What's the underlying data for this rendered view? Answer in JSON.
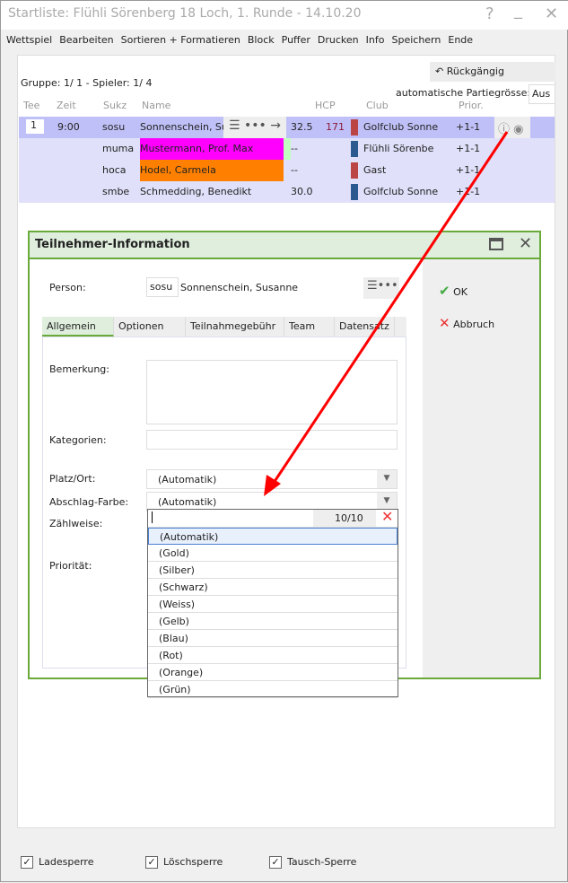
{
  "window": {
    "title": "Startliste: Flühli Sörenberg 18 Loch, 1. Runde - 14.10.20",
    "help": "?",
    "minimize": "_",
    "close": "✕"
  },
  "menu": [
    "Wettspiel",
    "Bearbeiten",
    "Sortieren + Formatieren",
    "Block",
    "Puffer",
    "Drucken",
    "Info",
    "Speichern",
    "Ende"
  ],
  "undo": "Rückgängig",
  "group_info": "Gruppe:  1/  1 - Spieler:  1/  4",
  "auto_label": "automatische Partiegrösse:",
  "auto_value": "Aus",
  "columns": [
    "Tee",
    "Zeit",
    "Sukz",
    "Name",
    "HCP",
    "Club",
    "Prior."
  ],
  "rows": [
    {
      "tee": "1",
      "time": "9:00",
      "code": "sosu",
      "name": "Sonnenschein, Sus",
      "hcp": "32.5",
      "extra": "171",
      "club": "Golfclub Sonne",
      "prior": "+1-1",
      "gender": "f"
    },
    {
      "code": "muma",
      "name": "Mustermann, Prof. Max",
      "hcp": "--",
      "club": "Flühli Sörenbe",
      "prior": "+1-1",
      "gender": "m",
      "color": "#ff00ff"
    },
    {
      "code": "hoca",
      "name": "Hodel, Carmela",
      "hcp": "--",
      "club": "Gast",
      "prior": "+1-1",
      "gender": "f",
      "color": "#ff8000"
    },
    {
      "code": "smbe",
      "name": "Schmedding, Benedikt",
      "hcp": "30.0",
      "club": "Golfclub Sonne",
      "prior": "+1-1",
      "gender": "m"
    }
  ],
  "dialog": {
    "title": "Teilnehmer-Information",
    "person_label": "Person:",
    "person_code": "sosu",
    "person_name": "Sonnenschein, Susanne",
    "ok": "OK",
    "cancel": "Abbruch",
    "tabs": [
      "Allgemein",
      "Optionen",
      "Teilnahmegebühr",
      "Team",
      "Datensatz"
    ],
    "bemerkung": "Bemerkung:",
    "kategorien": "Kategorien:",
    "platz": "Platz/Ort:",
    "platz_value": "(Automatik)",
    "abschlag": "Abschlag-Farbe:",
    "abschlag_value": "(Automatik)",
    "zaehlweise": "Zählweise:",
    "prioritaet": "Priorität:"
  },
  "dropdown": {
    "count": "10/10",
    "options": [
      "(Automatik)",
      "(Gold)",
      "(Silber)",
      "(Schwarz)",
      "(Weiss)",
      "(Gelb)",
      "(Blau)",
      "(Rot)",
      "(Orange)",
      "(Grün)"
    ]
  },
  "footer": [
    "Ladesperre",
    "Löschsperre",
    "Tausch-Sperre"
  ]
}
